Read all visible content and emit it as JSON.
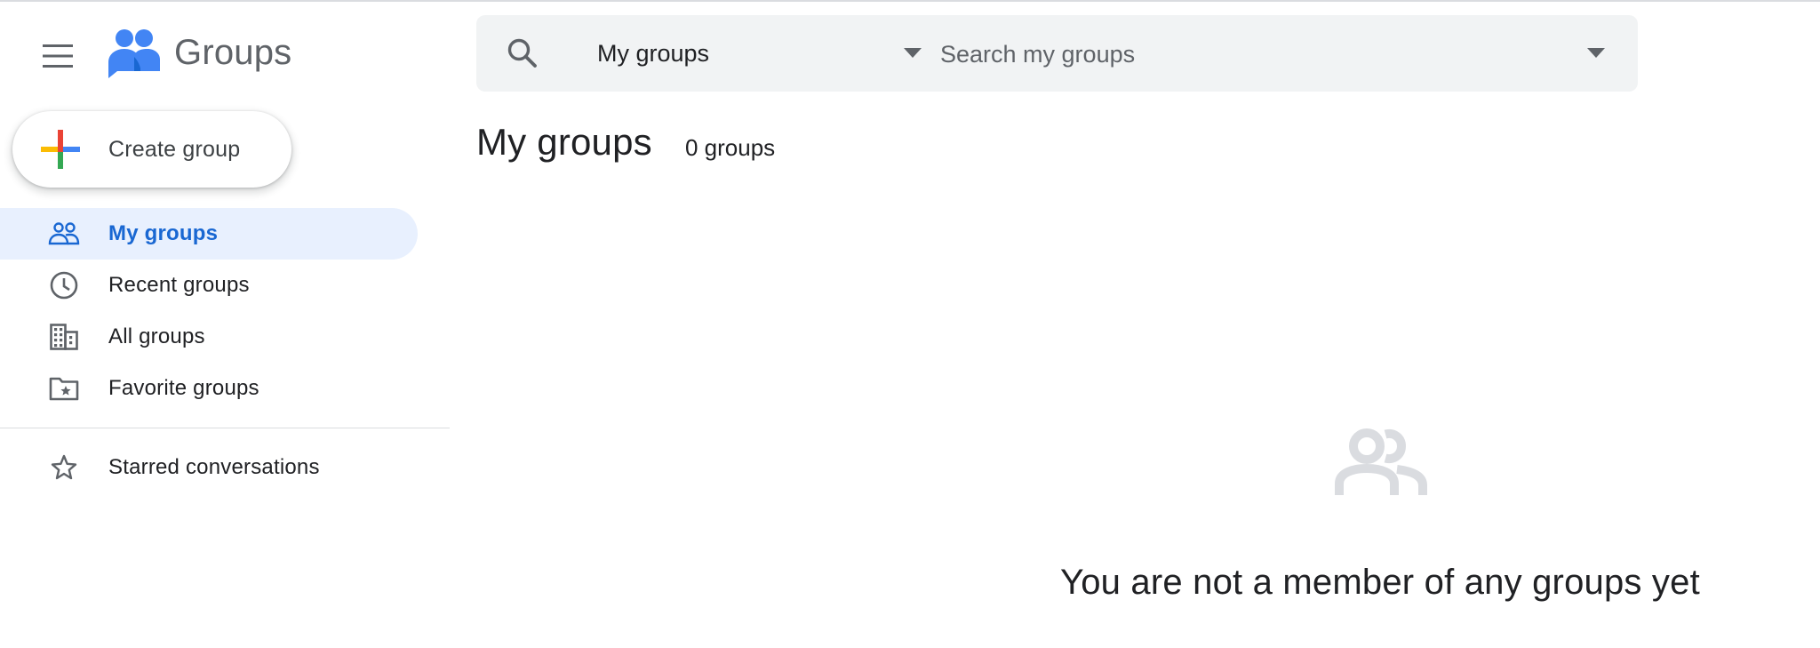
{
  "app": {
    "name": "Groups"
  },
  "sidebar": {
    "create_label": "Create group",
    "items": [
      {
        "label": "My groups",
        "icon": "people-outline-icon"
      },
      {
        "label": "Recent groups",
        "icon": "clock-icon"
      },
      {
        "label": "All groups",
        "icon": "building-icon"
      },
      {
        "label": "Favorite groups",
        "icon": "folder-star-icon"
      },
      {
        "label": "Starred conversations",
        "icon": "star-outline-icon"
      }
    ]
  },
  "search": {
    "scope_value": "My groups",
    "placeholder": "Search my groups"
  },
  "main": {
    "title": "My groups",
    "count": "0 groups",
    "empty_message": "You are not a member of any groups yet"
  },
  "colors": {
    "active_bg": "#e8f0fe",
    "active_text": "#1967d2",
    "search_bg": "#f1f3f4",
    "plus_red": "#ea4335",
    "plus_blue": "#4285f4",
    "plus_green": "#34a853",
    "plus_yellow": "#fbbc04"
  }
}
